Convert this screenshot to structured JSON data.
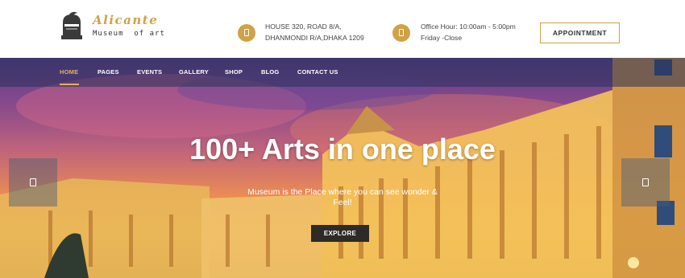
{
  "brand": {
    "title": "Alicante",
    "subtitle": "Museum  of art",
    "logo_icon": "knight-helmet-icon"
  },
  "header": {
    "address": {
      "icon": "phone-icon",
      "line1": "HOUSE 320, ROAD 8/A,",
      "line2": "DHANMONDI R/A,DHAKA 1209"
    },
    "hours": {
      "icon": "phone-icon",
      "line1": "Office Hour: 10:00am - 5:00pm",
      "line2": "Friday -Close"
    },
    "appointment_label": "APPOINTMENT",
    "accent_color": "#d0a248"
  },
  "nav": {
    "items": [
      {
        "label": "HOME",
        "active": true
      },
      {
        "label": "PAGES",
        "active": false
      },
      {
        "label": "EVENTS",
        "active": false
      },
      {
        "label": "GALLERY",
        "active": false
      },
      {
        "label": "SHOP",
        "active": false
      },
      {
        "label": "BLOG",
        "active": false
      },
      {
        "label": "CONTACT US",
        "active": false
      }
    ]
  },
  "hero": {
    "title": "100+ Arts in one place",
    "subtitle": "Museum is the Place where you can see wonder & Feel!",
    "button_label": "EXPLORE",
    "prev_icon": "arrow-left-icon",
    "next_icon": "arrow-right-icon"
  }
}
